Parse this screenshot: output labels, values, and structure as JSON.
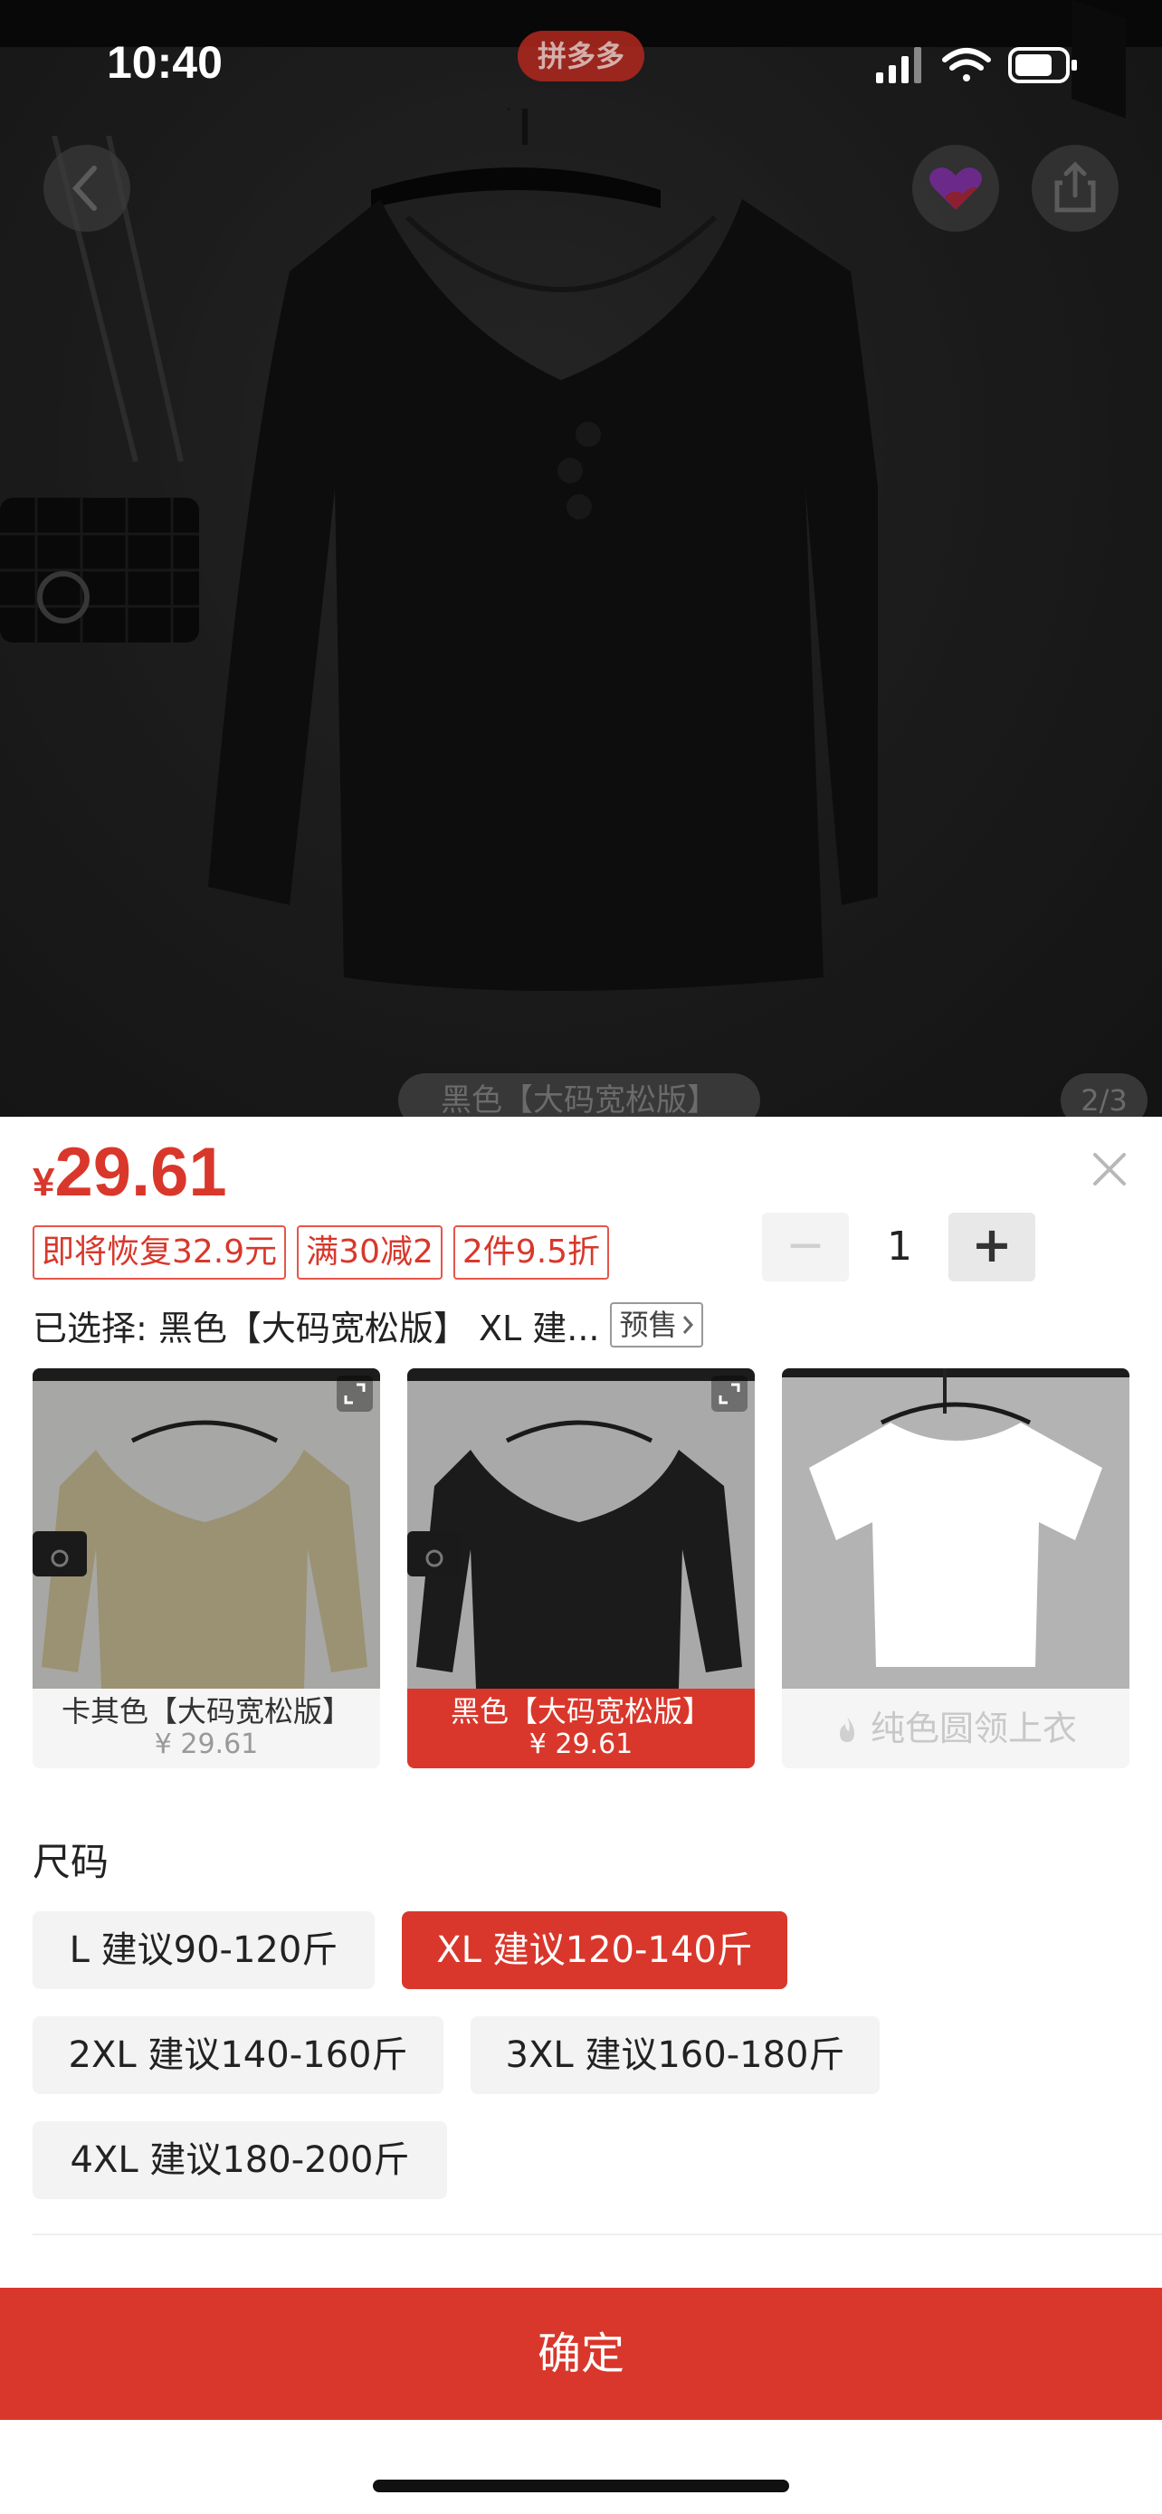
{
  "status_bar": {
    "time": "10:40",
    "app_badge": "拼多多"
  },
  "gallery": {
    "caption": "黑色【大码宽松版】",
    "page_indicator": "2/3"
  },
  "product": {
    "currency": "¥",
    "price": "29.61",
    "tags": [
      "即将恢复32.9元",
      "满30减2",
      "2件9.5折"
    ],
    "quantity": "1",
    "minus_label": "−",
    "plus_label": "+",
    "selected_text": "已选择: 黑色【大码宽松版】 XL 建...",
    "presale_label": "预售"
  },
  "variants": [
    {
      "label": "卡其色【大码宽松版】",
      "price": "¥ 29.61",
      "selected": false,
      "color": "#9b9273"
    },
    {
      "label": "黑色【大码宽松版】",
      "price": "¥ 29.61",
      "selected": true,
      "color": "#1b1b1b"
    },
    {
      "label": "纯色圆领上衣",
      "price": "",
      "selected": false,
      "color": "#ffffff"
    }
  ],
  "size_section": {
    "title": "尺码",
    "options": [
      {
        "label": "L 建议90-120斤",
        "selected": false
      },
      {
        "label": "XL 建议120-140斤",
        "selected": true
      },
      {
        "label": "2XL 建议140-160斤",
        "selected": false
      },
      {
        "label": "3XL 建议160-180斤",
        "selected": false
      },
      {
        "label": "4XL 建议180-200斤",
        "selected": false
      }
    ]
  },
  "confirm_label": "确定",
  "colors": {
    "accent": "#d9372b"
  }
}
